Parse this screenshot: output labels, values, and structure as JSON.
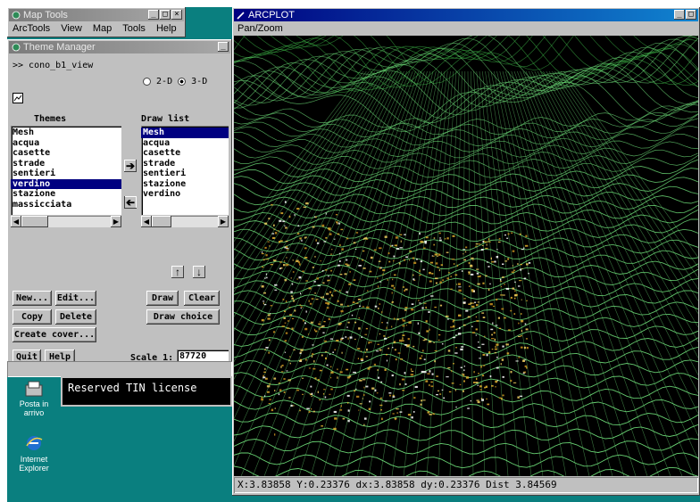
{
  "map_tools": {
    "title": "Map Tools",
    "menu": [
      "ArcTools",
      "View",
      "Map",
      "Tools",
      "Help"
    ]
  },
  "theme_manager": {
    "title": "Theme Manager",
    "view_name": ">> cono_b1_view",
    "mode_2d_label": "2-D",
    "mode_3d_label": "3-D",
    "mode_selected": "3-D",
    "themes_header": "Themes",
    "draw_list_header": "Draw list",
    "themes": [
      "Mesh",
      "acqua",
      "casette",
      "strade",
      "sentieri",
      "verdino",
      "stazione",
      "massicciata"
    ],
    "themes_selected": "verdino",
    "draw_list": [
      "Mesh",
      "acqua",
      "casette",
      "strade",
      "sentieri",
      "stazione",
      "verdino"
    ],
    "draw_list_selected": "Mesh",
    "buttons": {
      "new": "New...",
      "edit": "Edit...",
      "copy": "Copy",
      "delete": "Delete",
      "create_cover": "Create cover...",
      "draw": "Draw",
      "clear": "Clear",
      "draw_choice": "Draw choice",
      "quit": "Quit",
      "help": "Help"
    },
    "scale_label": "Scale  1:",
    "scale_value": "87720"
  },
  "arcplot": {
    "title": "ARCPLOT",
    "menu": [
      "Pan/Zoom"
    ],
    "status": "X:3.83858 Y:0.23376 dx:3.83858 dy:0.23376 Dist 3.84569"
  },
  "console": {
    "message": "Reserved TIN license"
  },
  "desktop_icons": [
    {
      "label_line1": "Posta in",
      "label_line2": "arrivo"
    },
    {
      "label_line1": "Internet",
      "label_line2": "Explorer"
    }
  ],
  "colors": {
    "desktop": "#0a7f7f",
    "mesh_green": "#6fe07a",
    "selection": "#000080"
  }
}
